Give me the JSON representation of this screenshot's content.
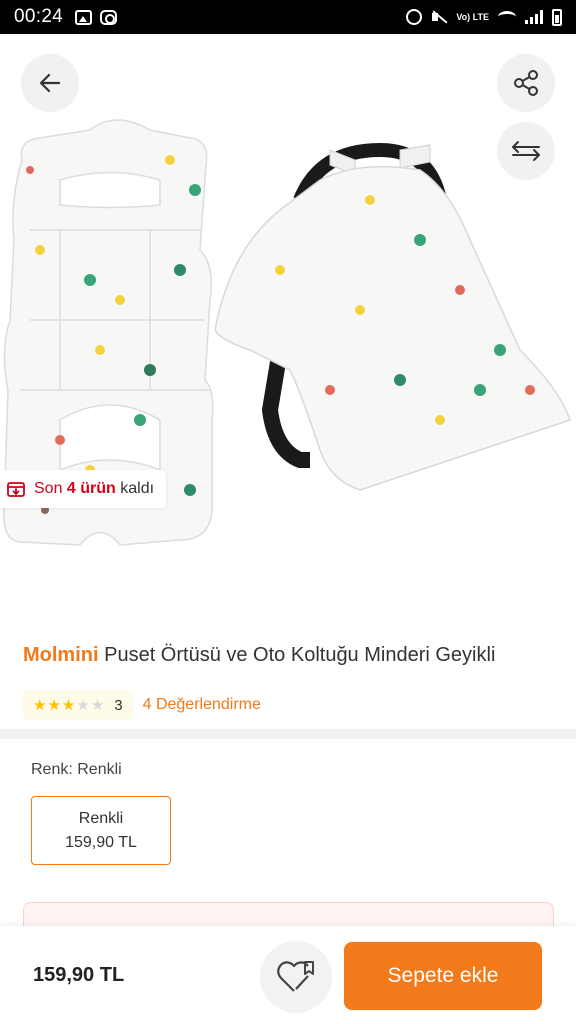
{
  "status_bar": {
    "time": "00:24",
    "lte": "Vo) LTE"
  },
  "stock": {
    "prefix": "Son ",
    "count": "4 ürün",
    "suffix": " kaldı"
  },
  "product": {
    "brand": "Molmini",
    "name": " Puset Örtüsü ve Oto Koltuğu Minderi Geyikli",
    "rating_value": 3,
    "rating_max": 5,
    "rating_text": "3",
    "reviews_link": "4 Değerlendirme"
  },
  "variant": {
    "label": "Renk: Renkli",
    "option_name": "Renkli",
    "option_price": "159,90 TL"
  },
  "bottom_bar": {
    "price": "159,90 TL",
    "add_to_cart": "Sepete ekle"
  },
  "icons": {
    "back": "arrow-left-icon",
    "share": "share-icon",
    "compare": "swap-arrows-icon",
    "stock": "box-icon",
    "favorite": "heart-icon"
  },
  "colors": {
    "accent": "#f27a1a",
    "stock_red": "#d0021b",
    "star": "#ffc000"
  }
}
